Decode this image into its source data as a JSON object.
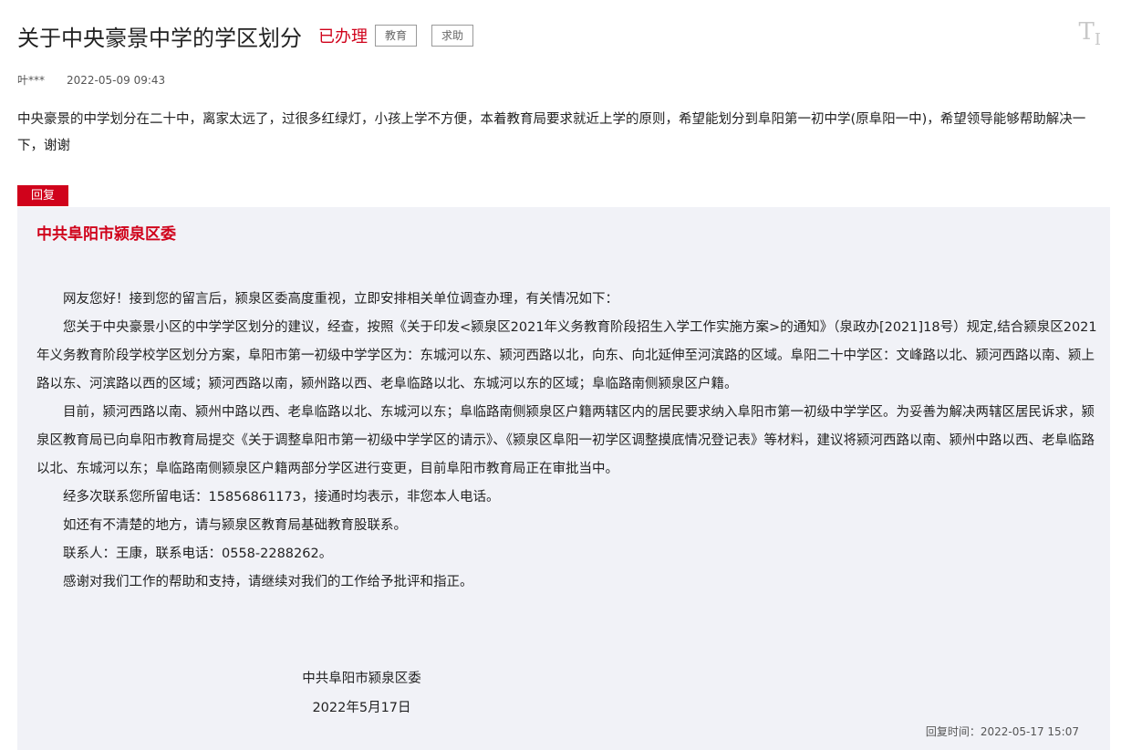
{
  "header": {
    "title": "关于中央豪景中学的学区划分",
    "status": "已办理",
    "tags": [
      "教育",
      "求助"
    ],
    "font_toggle": "T"
  },
  "meta": {
    "author": "叶***",
    "date": "2022-05-09 09:43"
  },
  "question": "中央豪景的中学划分在二十中，离家太远了，过很多红绿灯，小孩上学不方便，本着教育局要求就近上学的原则，希望能划分到阜阳第一初中学(原阜阳一中)，希望领导能够帮助解决一下，谢谢",
  "reply": {
    "badge": "回复",
    "org": "中共阜阳市颍泉区委",
    "paragraphs": [
      "网友您好！接到您的留言后，颍泉区委高度重视，立即安排相关单位调查办理，有关情况如下：",
      "您关于中央豪景小区的中学学区划分的建议，经查，按照《关于印发<颍泉区2021年义务教育阶段招生入学工作实施方案>的通知》（泉政办[2021]18号）规定,结合颍泉区2021年义务教育阶段学校学区划分方案，阜阳市第一初级中学学区为：东城河以东、颍河西路以北，向东、向北延伸至河滨路的区域。阜阳二十中学区：文峰路以北、颍河西路以南、颍上路以东、河滨路以西的区域；颍河西路以南，颍州路以西、老阜临路以北、东城河以东的区域；阜临路南侧颍泉区户籍。",
      "目前，颍河西路以南、颍州中路以西、老阜临路以北、东城河以东；阜临路南侧颍泉区户籍两辖区内的居民要求纳入阜阳市第一初级中学学区。为妥善为解决两辖区居民诉求，颍泉区教育局已向阜阳市教育局提交《关于调整阜阳市第一初级中学学区的请示》、《颍泉区阜阳一初学区调整摸底情况登记表》等材料，建议将颍河西路以南、颍州中路以西、老阜临路以北、东城河以东；阜临路南侧颍泉区户籍两部分学区进行变更，目前阜阳市教育局正在审批当中。",
      "经多次联系您所留电话：15856861173，接通时均表示，非您本人电话。",
      "如还有不清楚的地方，请与颍泉区教育局基础教育股联系。",
      "联系人：王康，联系电话：0558-2288262。",
      "感谢对我们工作的帮助和支持，请继续对我们的工作给予批评和指正。"
    ],
    "signature": "中共阜阳市颍泉区委",
    "signature_date": "2022年5月17日",
    "reply_time": "回复时间：2022-05-17 15:07"
  },
  "colors": {
    "accent": "#d0021b",
    "reply_bg": "#f1f2f7"
  }
}
